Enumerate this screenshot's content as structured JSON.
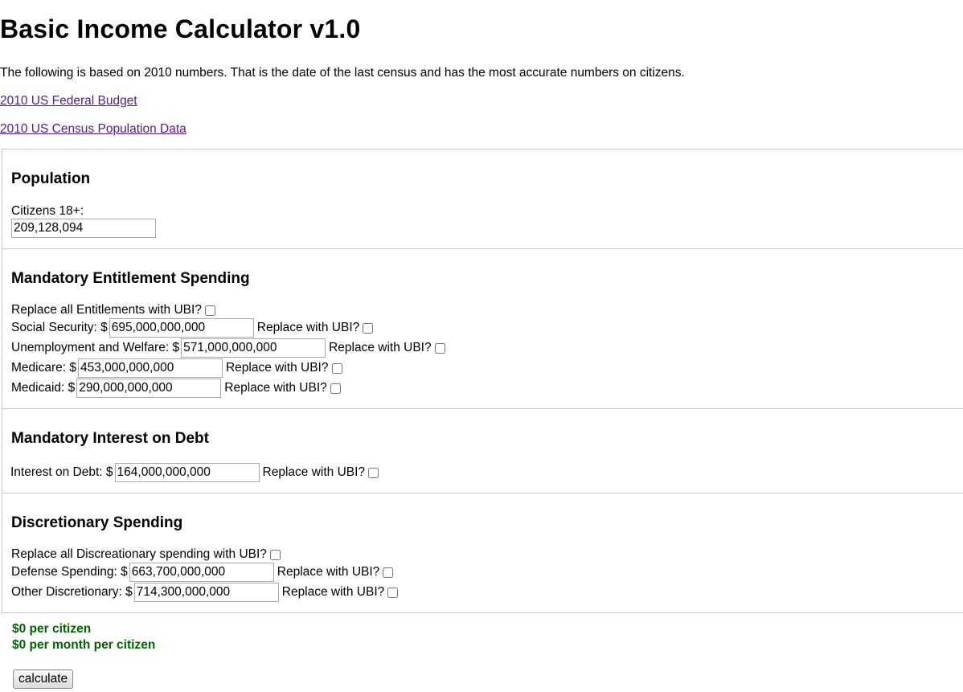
{
  "title": "Basic Income Calculator v1.0",
  "intro": "The following is based on 2010 numbers. That is the date of the last census and has the most accurate numbers on citizens.",
  "links": [
    "2010 US Federal Budget",
    "2010 US Census Population Data"
  ],
  "population": {
    "heading": "Population",
    "citizens_label": "Citizens 18+:",
    "citizens_value": "209,128,094"
  },
  "replace_label": "Replace with UBI?",
  "mandatory": {
    "heading": "Mandatory Entitlement Spending",
    "replace_all_label": "Replace all Entitlements with UBI?",
    "items": [
      {
        "label": "Social Security: $",
        "value": "695,000,000,000"
      },
      {
        "label": "Unemployment and Welfare: $",
        "value": "571,000,000,000"
      },
      {
        "label": "Medicare: $",
        "value": "453,000,000,000"
      },
      {
        "label": "Medicaid: $",
        "value": "290,000,000,000"
      }
    ]
  },
  "interest": {
    "heading": "Mandatory Interest on Debt",
    "label": "Interest on Debt: $",
    "value": "164,000,000,000"
  },
  "discretionary": {
    "heading": "Discretionary Spending",
    "replace_all_label": "Replace all Discreationary spending with UBI?",
    "items": [
      {
        "label": "Defense Spending: $",
        "value": "663,700,000,000"
      },
      {
        "label": "Other Discretionary: $",
        "value": "714,300,000,000"
      }
    ]
  },
  "results": {
    "per_citizen": "$0 per citizen",
    "per_month": "$0 per month per citizen"
  },
  "calculate_label": "calculate"
}
